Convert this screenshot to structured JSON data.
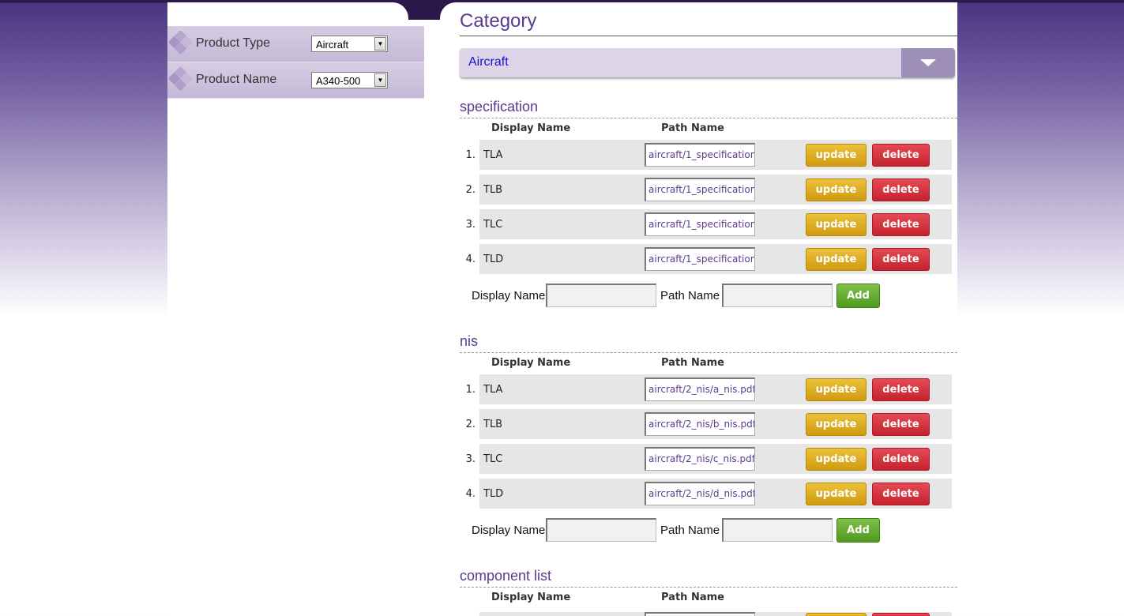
{
  "filters": [
    {
      "label": "Product Type",
      "value": "Aircraft"
    },
    {
      "label": "Product Name",
      "value": "A340-500"
    }
  ],
  "category": {
    "title": "Category",
    "selected": "Aircraft"
  },
  "columns": {
    "display": "Display Name",
    "path": "Path Name"
  },
  "buttons": {
    "update": "update",
    "delete": "delete",
    "add": "Add"
  },
  "add_form": {
    "display_label": "Display Name",
    "path_label": "Path Name"
  },
  "sections": [
    {
      "title": "specification",
      "rows": [
        {
          "num": "1.",
          "name": "TLA",
          "path": "aircraft/1_specification"
        },
        {
          "num": "2.",
          "name": "TLB",
          "path": "aircraft/1_specification"
        },
        {
          "num": "3.",
          "name": "TLC",
          "path": "aircraft/1_specification"
        },
        {
          "num": "4.",
          "name": "TLD",
          "path": "aircraft/1_specification"
        }
      ]
    },
    {
      "title": "nis",
      "rows": [
        {
          "num": "1.",
          "name": "TLA",
          "path": "aircraft/2_nis/a_nis.pdf"
        },
        {
          "num": "2.",
          "name": "TLB",
          "path": "aircraft/2_nis/b_nis.pdf"
        },
        {
          "num": "3.",
          "name": "TLC",
          "path": "aircraft/2_nis/c_nis.pdf"
        },
        {
          "num": "4.",
          "name": "TLD",
          "path": "aircraft/2_nis/d_nis.pdf"
        }
      ]
    },
    {
      "title": "component list",
      "rows": []
    }
  ],
  "colors": {
    "accent": "#5b3a8e",
    "update": "#dba81f",
    "delete": "#d5333e",
    "add": "#62a930"
  }
}
